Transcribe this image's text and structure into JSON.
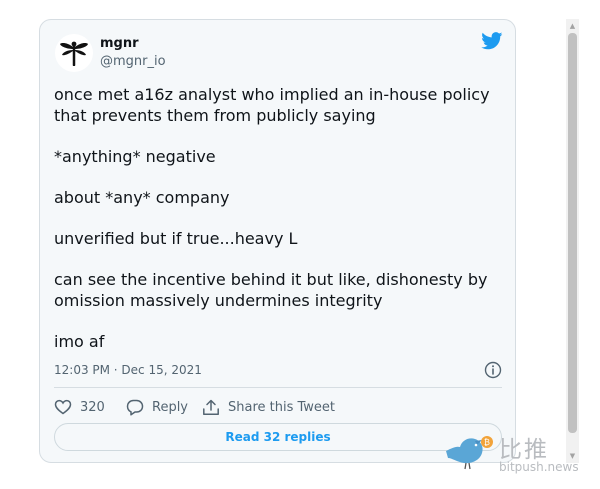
{
  "tweet": {
    "user": {
      "name": "mgnr",
      "handle": "@mgnr_io"
    },
    "paragraphs": [
      "once met a16z analyst who implied an in-house policy\nthat prevents them from publicly saying",
      "*anything* negative",
      "about *any* company",
      "unverified but if true...heavy L",
      "can see the incentive behind it but like, dishonesty by\nomission massively undermines integrity",
      "imo af"
    ],
    "timestamp": "12:03 PM · Dec 15, 2021",
    "actions": {
      "like_count": "320",
      "reply_label": "Reply",
      "share_label": "Share this Tweet"
    },
    "read_replies_label": "Read 32 replies"
  },
  "watermark": {
    "brand_cn": "比推",
    "url": "bitpush.news"
  },
  "colors": {
    "accent": "#1d9bf0",
    "card_bg": "#f5f8fa",
    "secondary_text": "#536471",
    "watermark_bird": "#5aa6d6",
    "watermark_coin": "#f2a33a"
  },
  "icons": {
    "avatar": "dragonfly-icon",
    "brand": "twitter-bird-icon",
    "info": "info-icon",
    "like": "heart-icon",
    "reply": "reply-bubble-icon",
    "share": "share-icon"
  }
}
